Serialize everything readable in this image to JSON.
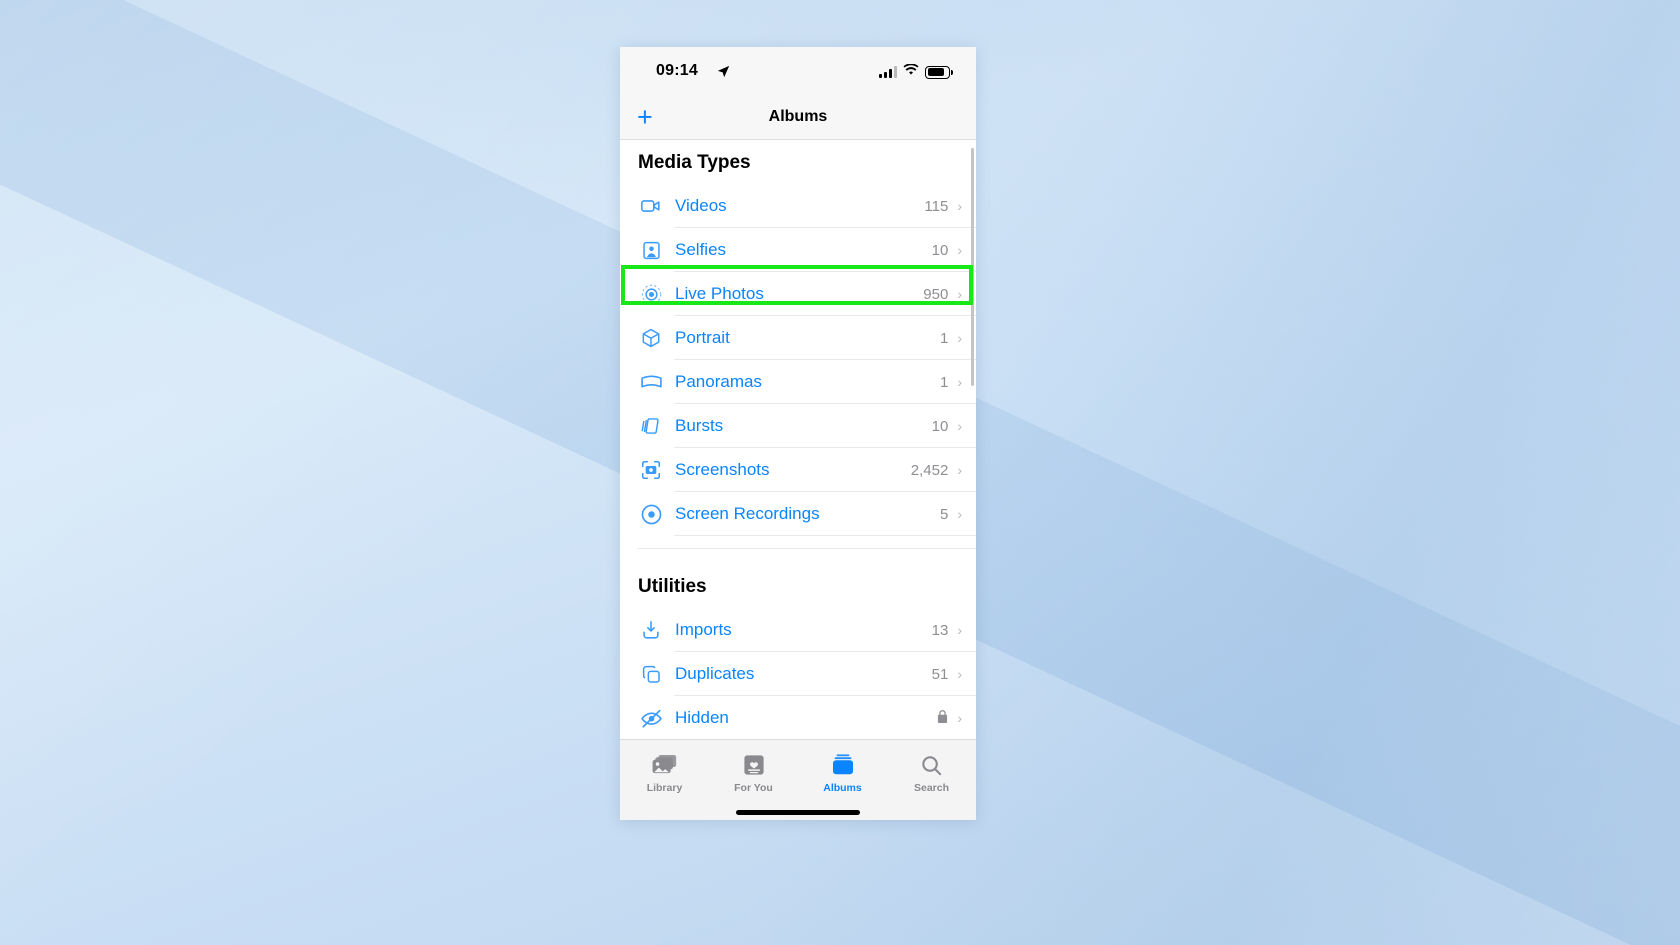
{
  "status_bar": {
    "time": "09:14",
    "location_icon": "location-arrow-icon",
    "cellular_icon": "cellular-bars-icon",
    "wifi_icon": "wifi-icon",
    "battery_icon": "battery-icon"
  },
  "nav_bar": {
    "title": "Albums",
    "add_label": "+"
  },
  "sections": [
    {
      "heading": "Media Types",
      "rows": [
        {
          "icon": "video-camera-icon",
          "label": "Videos",
          "count": "115",
          "chevron": "›"
        },
        {
          "icon": "person-portrait-icon",
          "label": "Selfies",
          "count": "10",
          "chevron": "›"
        },
        {
          "icon": "live-photo-icon",
          "label": "Live Photos",
          "count": "950",
          "chevron": "›"
        },
        {
          "icon": "cube-icon",
          "label": "Portrait",
          "count": "1",
          "chevron": "›"
        },
        {
          "icon": "panorama-icon",
          "label": "Panoramas",
          "count": "1",
          "chevron": "›"
        },
        {
          "icon": "burst-stack-icon",
          "label": "Bursts",
          "count": "10",
          "chevron": "›"
        },
        {
          "icon": "screenshot-camera-icon",
          "label": "Screenshots",
          "count": "2,452",
          "chevron": "›"
        },
        {
          "icon": "screen-recording-icon",
          "label": "Screen Recordings",
          "count": "5",
          "chevron": "›"
        }
      ]
    },
    {
      "heading": "Utilities",
      "rows": [
        {
          "icon": "import-download-icon",
          "label": "Imports",
          "count": "13",
          "chevron": "›"
        },
        {
          "icon": "duplicates-copy-icon",
          "label": "Duplicates",
          "count": "51",
          "chevron": "›"
        },
        {
          "icon": "eye-slash-hidden-icon",
          "label": "Hidden",
          "count": "",
          "lock": "lock-icon",
          "chevron": "›"
        }
      ]
    }
  ],
  "tab_bar": [
    {
      "icon": "photo-stack-icon",
      "label": "Library",
      "active": false
    },
    {
      "icon": "for-you-card-icon",
      "label": "For You",
      "active": false
    },
    {
      "icon": "albums-folder-icon",
      "label": "Albums",
      "active": true
    },
    {
      "icon": "search-magnifier-icon",
      "label": "Search",
      "active": false
    }
  ],
  "highlight": {
    "target_label": "Live Photos",
    "color": "#18e718"
  },
  "colors": {
    "accent_blue": "#0a84ff",
    "icon_blue": "#3b9bfa",
    "count_gray": "#8e8e93",
    "bar_bg": "#f7f7f8",
    "backdrop": "#bcd7f0"
  }
}
